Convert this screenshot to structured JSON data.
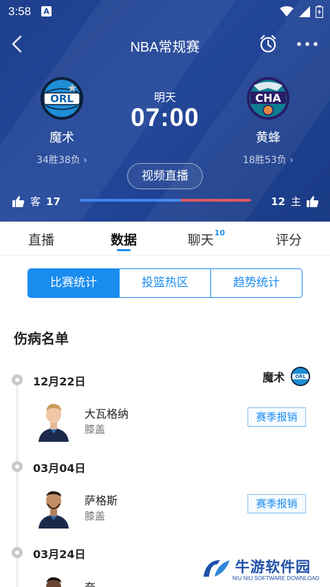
{
  "status_bar": {
    "time": "3:58",
    "notif_badge": "A"
  },
  "nav": {
    "title": "NBA常规赛"
  },
  "match": {
    "home": {
      "name": "魔术",
      "record": "34胜38负",
      "abbr": "ORL"
    },
    "away": {
      "name": "黄蜂",
      "record": "18胜53负",
      "abbr": "CHA"
    },
    "day": "明天",
    "time": "07:00",
    "live_button": "视频直播"
  },
  "votes": {
    "away_label": "客",
    "away_count": "17",
    "home_label": "主",
    "home_count": "12",
    "away_share": 0.59,
    "away_color": "#3f86f1",
    "home_color": "#e0505a"
  },
  "tabs": [
    {
      "label": "直播"
    },
    {
      "label": "数据"
    },
    {
      "label": "聊天",
      "badge": "10"
    },
    {
      "label": "评分"
    }
  ],
  "segments": [
    "比赛统计",
    "投篮热区",
    "趋势统计"
  ],
  "injury": {
    "title": "伤病名单",
    "team_name": "魔术",
    "team_abbr": "ORL",
    "entries": [
      {
        "date": "12月22日",
        "player": "大瓦格纳",
        "part": "膝盖",
        "status": "赛季报销"
      },
      {
        "date": "03月04日",
        "player": "萨格斯",
        "part": "膝盖",
        "status": "赛季报销"
      },
      {
        "date": "03月24日",
        "player": "奈",
        "part": ""
      }
    ]
  },
  "watermark": {
    "name": "牛游软件园",
    "sub": "NIU NIU SOFTWARE DOWNLOAD"
  },
  "colors": {
    "header_bg": "#23479a",
    "accent": "#1a8cf0"
  }
}
